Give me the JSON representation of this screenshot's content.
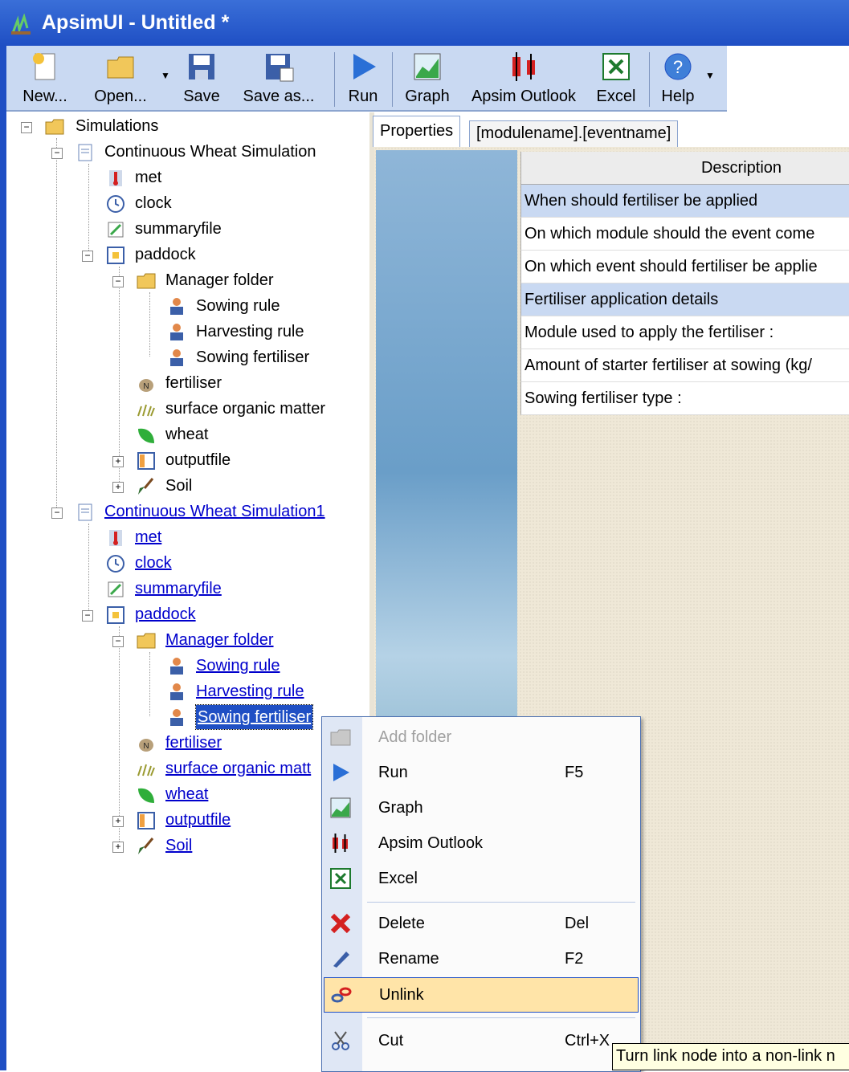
{
  "window": {
    "title": "ApsimUI - Untitled *"
  },
  "toolbar": {
    "new": "New...",
    "open": "Open...",
    "save": "Save",
    "save_as": "Save as...",
    "run": "Run",
    "graph": "Graph",
    "outlook": "Apsim Outlook",
    "excel": "Excel",
    "help": "Help"
  },
  "tree": {
    "root": "Simulations",
    "sim1": {
      "name": "Continuous Wheat Simulation",
      "met": "met",
      "clock": "clock",
      "summaryfile": "summaryfile",
      "paddock": "paddock",
      "manager_folder": "Manager folder",
      "sowing_rule": "Sowing rule",
      "harvesting_rule": "Harvesting rule",
      "sowing_fertiliser": "Sowing fertiliser",
      "fertiliser": "fertiliser",
      "surface_om": "surface organic matter",
      "wheat": "wheat",
      "outputfile": "outputfile",
      "soil": "Soil"
    },
    "sim2": {
      "name": "Continuous Wheat Simulation1",
      "met": "met",
      "clock": "clock",
      "summaryfile": "summaryfile",
      "paddock": "paddock",
      "manager_folder": "Manager folder",
      "sowing_rule": "Sowing rule",
      "harvesting_rule": "Harvesting rule",
      "sowing_fertiliser": "Sowing fertiliser",
      "fertiliser": "fertiliser",
      "surface_om": "surface organic matt",
      "wheat": "wheat",
      "outputfile": "outputfile",
      "soil": "Soil"
    }
  },
  "tabs": {
    "properties": "Properties",
    "event": "[modulename].[eventname]"
  },
  "grid": {
    "header": "Description",
    "rows": [
      "When should fertiliser be applied",
      "On which module should the event come",
      "On which event should fertiliser be applie",
      "Fertiliser application details",
      "Module used to apply the fertiliser :",
      "Amount of starter fertiliser at sowing (kg/",
      "Sowing fertiliser type :"
    ]
  },
  "context_menu": {
    "add_folder": "Add folder",
    "run": "Run",
    "run_sc": "F5",
    "graph": "Graph",
    "outlook": "Apsim Outlook",
    "excel": "Excel",
    "delete": "Delete",
    "delete_sc": "Del",
    "rename": "Rename",
    "rename_sc": "F2",
    "unlink": "Unlink",
    "cut": "Cut",
    "cut_sc": "Ctrl+X"
  },
  "tooltip": "Turn link node into a non-link n",
  "colors": {
    "title_bar": "#1f4fc4",
    "toolbar": "#c9d9f2",
    "link": "#0000cc",
    "hover": "#ffe4a8"
  }
}
